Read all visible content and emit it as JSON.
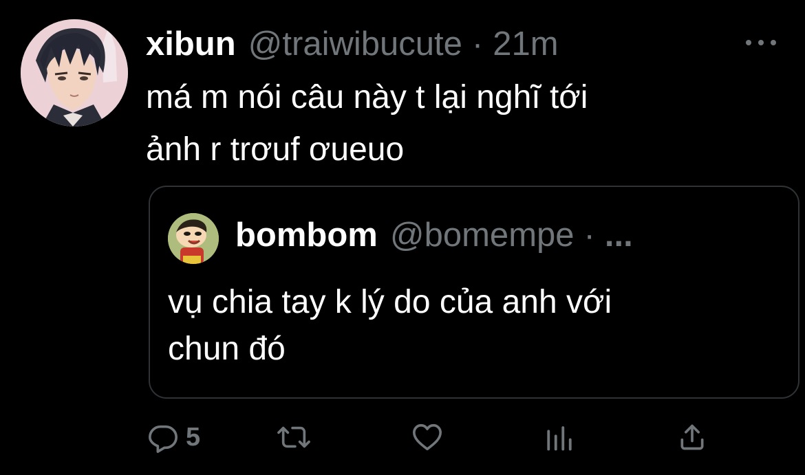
{
  "tweet": {
    "display_name": "xibun",
    "handle": "@traiwibucute",
    "separator": "·",
    "time": "21m",
    "text": "má m nói câu này t lại nghĩ tới\nảnh r trơuf ơueuo",
    "avatar_icon": "anime-character-avatar",
    "more_icon": "more-options-icon"
  },
  "quoted": {
    "display_name": "bombom",
    "handle": "@bomempe",
    "separator": "·",
    "ellipsis": "...",
    "text": "vụ chia tay k lý do của anh với\nchun đó",
    "avatar_icon": "cartoon-character-avatar"
  },
  "actions": {
    "reply_icon": "reply-icon",
    "reply_count": "5",
    "retweet_icon": "retweet-icon",
    "like_icon": "heart-icon",
    "analytics_icon": "analytics-icon",
    "share_icon": "share-icon"
  },
  "colors": {
    "background": "#000000",
    "text": "#ffffff",
    "secondary": "#71767b",
    "border": "#2f3336"
  }
}
